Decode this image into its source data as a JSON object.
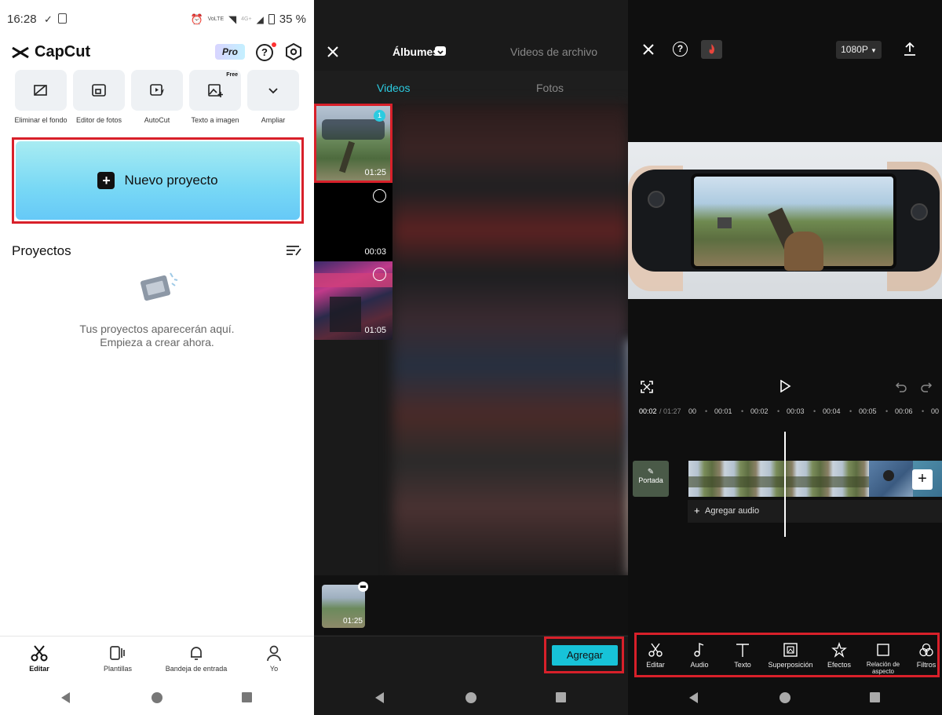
{
  "home": {
    "status": {
      "time": "16:28",
      "battery": "35 %",
      "net_top": "VoLTE",
      "net_gen": "4G+"
    },
    "app_name": "CapCut",
    "pro_badge": "Pro",
    "tools": [
      {
        "label": "Eliminar el fondo",
        "icon": "remove-background-icon"
      },
      {
        "label": "Editor de fotos",
        "icon": "photo-editor-icon"
      },
      {
        "label": "AutoCut",
        "icon": "autocut-icon"
      },
      {
        "label": "Texto a imagen",
        "icon": "text-to-image-icon",
        "badge": "Free"
      },
      {
        "label": "Ampliar",
        "icon": "chevron-down-icon"
      }
    ],
    "new_project": "Nuevo proyecto",
    "projects_title": "Proyectos",
    "empty_line1": "Tus proyectos aparecerán aquí.",
    "empty_line2": "Empieza a crear ahora.",
    "nav": [
      {
        "label": "Editar",
        "icon": "scissors-icon",
        "active": true
      },
      {
        "label": "Plantillas",
        "icon": "templates-icon"
      },
      {
        "label": "Bandeja de entrada",
        "icon": "bell-icon"
      },
      {
        "label": "Yo",
        "icon": "profile-icon"
      }
    ]
  },
  "picker": {
    "header_tab_albums": "Álbumes",
    "header_tab_archive": "Videos de archivo",
    "tab_videos": "Videos",
    "tab_photos": "Fotos",
    "accent": "#2ccbe0",
    "items": [
      {
        "duration": "01:25",
        "selected_index": "1"
      },
      {
        "duration": "00:03"
      },
      {
        "duration": "01:05"
      }
    ],
    "tray_item_duration": "01:25",
    "add_button": "Agregar"
  },
  "editor": {
    "resolution": "1080P",
    "time_current": "00:02",
    "time_total": "/ 01:27",
    "ruler_ticks": [
      "00",
      "00:01",
      "00:02",
      "00:03",
      "00:04",
      "00:05",
      "00:06",
      "00"
    ],
    "cover_label": "Portada",
    "add_audio": "Agregar audio",
    "toolbar": [
      {
        "label": "Editar",
        "icon": "scissors-icon"
      },
      {
        "label": "Audio",
        "icon": "music-note-icon"
      },
      {
        "label": "Texto",
        "icon": "text-icon"
      },
      {
        "label": "Superposición",
        "icon": "overlay-icon"
      },
      {
        "label": "Efectos",
        "icon": "effects-icon"
      },
      {
        "label": "Relación de aspecto",
        "icon": "aspect-ratio-icon"
      },
      {
        "label": "Filtros",
        "icon": "filters-icon"
      }
    ]
  }
}
